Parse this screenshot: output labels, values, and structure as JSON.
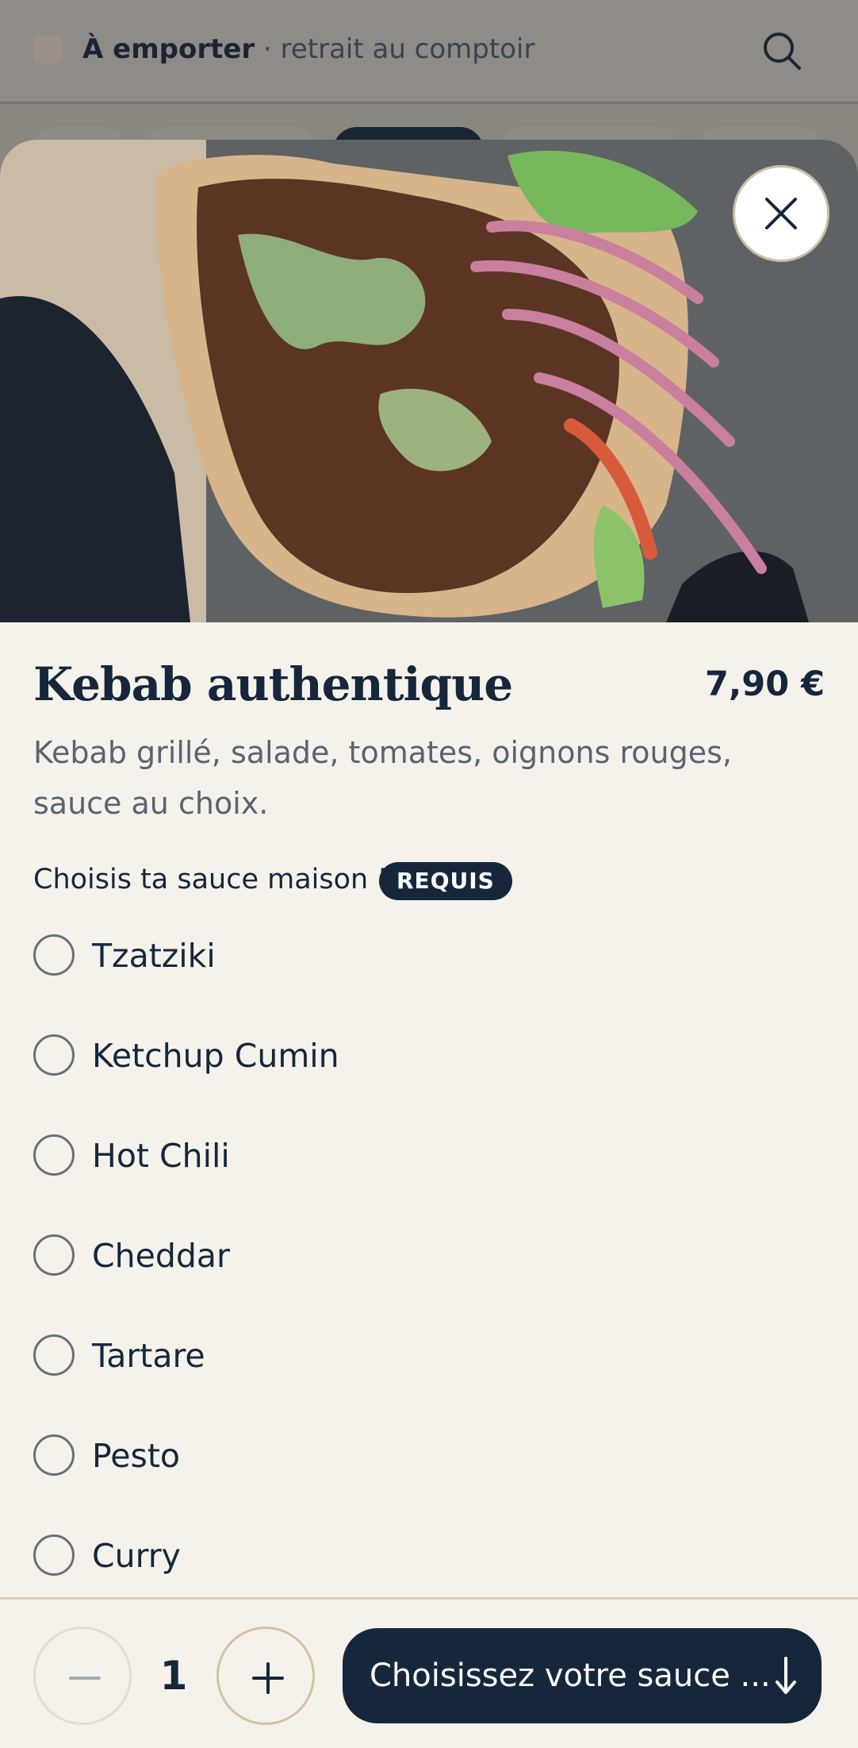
{
  "header": {
    "mode": "À emporter",
    "mode_detail": "· retrait au comptoir"
  },
  "product": {
    "title": "Kebab authentique",
    "price": "7,90 €",
    "description": "Kebab grillé, salade, tomates, oignons rouges, sauce au choix."
  },
  "options_group": {
    "label": "Choisis ta sauce maison !",
    "badge": "REQUIS",
    "options": [
      "Tzatziki",
      "Ketchup Cumin",
      "Hot Chili",
      "Cheddar",
      "Tartare",
      "Pesto",
      "Curry"
    ]
  },
  "footer": {
    "quantity": "1",
    "cta_label": "Choisissez votre sauce ..."
  },
  "colors": {
    "primary": "#16273b",
    "sheet_bg": "#f5f2ec",
    "muted_text": "#5b6370"
  }
}
